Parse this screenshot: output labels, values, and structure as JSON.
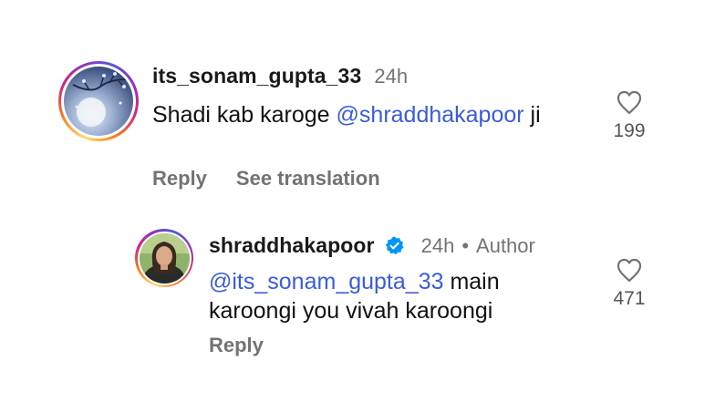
{
  "comments": [
    {
      "username": "its_sonam_gupta_33",
      "time": "24h",
      "text_before": "Shadi kab karoge ",
      "mention": "@shraddhakapoor",
      "text_after": " ji",
      "reply_label": "Reply",
      "translate_label": "See translation",
      "likes": "199",
      "avatar_icon": "night-sky-avatar",
      "like_icon": "heart-outline-icon"
    },
    {
      "username": "shraddhakapoor",
      "time": "24h",
      "separator": "•",
      "author_label": "Author",
      "mention": "@its_sonam_gupta_33",
      "text_after": " main karoongi you vivah karoongi",
      "reply_label": "Reply",
      "likes": "471",
      "verified_icon": "verified-badge-icon",
      "avatar_icon": "profile-photo-avatar",
      "like_icon": "heart-outline-icon"
    }
  ],
  "colors": {
    "mention": "#3b5bdb",
    "secondary_text": "#737373",
    "verified": "#0095f6"
  }
}
